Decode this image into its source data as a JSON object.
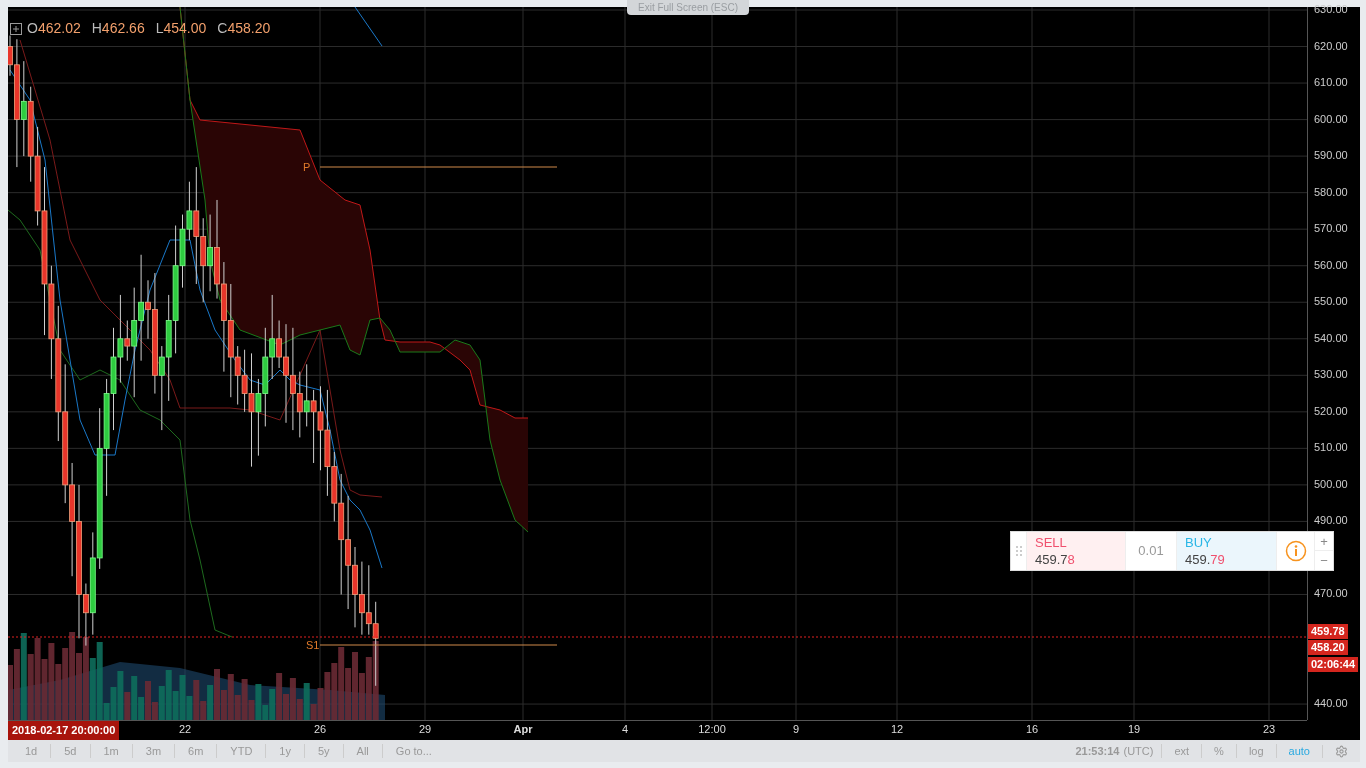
{
  "exit_button": "Exit Full Screen (ESC)",
  "ohlc": [
    {
      "letter": "O",
      "value": "462.02"
    },
    {
      "letter": "H",
      "value": "462.66"
    },
    {
      "letter": "L",
      "value": "454.00"
    },
    {
      "letter": "C",
      "value": "458.20"
    }
  ],
  "chart": {
    "price_ticks": [
      "630.00",
      "620.00",
      "610.00",
      "600.00",
      "590.00",
      "580.00",
      "570.00",
      "560.00",
      "550.00",
      "540.00",
      "530.00",
      "520.00",
      "510.00",
      "500.00",
      "490.00",
      "470.00",
      "440.00"
    ],
    "time_ticks": [
      {
        "label": "22",
        "kind": "day"
      },
      {
        "label": "26",
        "kind": "day"
      },
      {
        "label": "29",
        "kind": "day"
      },
      {
        "label": "Apr",
        "kind": "month"
      },
      {
        "label": "4",
        "kind": "day"
      },
      {
        "label": "12:00",
        "kind": "day"
      },
      {
        "label": "9",
        "kind": "day"
      },
      {
        "label": "12",
        "kind": "day"
      },
      {
        "label": "16",
        "kind": "day"
      },
      {
        "label": "19",
        "kind": "day"
      },
      {
        "label": "23",
        "kind": "day"
      }
    ],
    "cursor_time": "2018-02-17 20:00:00",
    "pivot_labels": [
      "P",
      "S1"
    ],
    "price_markers": [
      "459.78",
      "458.20",
      "02:06:44"
    ]
  },
  "trade_panel": {
    "sell": {
      "label": "SELL",
      "price": "459.7",
      "price_tail": "8"
    },
    "spread": "0.01",
    "buy": {
      "label": "BUY",
      "price": "459.",
      "price_tail": "79"
    },
    "zoom_in": "+",
    "zoom_out": "−"
  },
  "toolbar": {
    "ranges": [
      {
        "label": "1d",
        "selected": false
      },
      {
        "label": "5d",
        "selected": false
      },
      {
        "label": "1m",
        "selected": false
      },
      {
        "label": "3m",
        "selected": false
      },
      {
        "label": "6m",
        "selected": false
      },
      {
        "label": "YTD",
        "selected": false
      },
      {
        "label": "1y",
        "selected": false
      },
      {
        "label": "5y",
        "selected": false
      },
      {
        "label": "All",
        "selected": false
      }
    ],
    "goto": "Go to...",
    "clock": "21:53:14",
    "timezone": "(UTC)",
    "scales": [
      {
        "label": "ext",
        "selected": false
      },
      {
        "label": "%",
        "selected": false
      },
      {
        "label": "log",
        "selected": false
      },
      {
        "label": "auto",
        "selected": true
      }
    ]
  }
}
